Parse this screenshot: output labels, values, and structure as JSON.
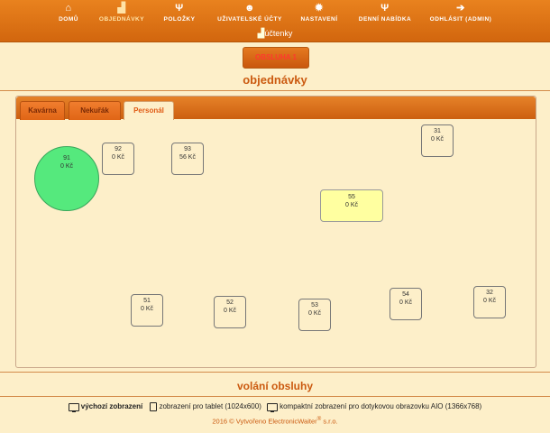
{
  "nav": {
    "items": [
      {
        "label": "DOMŮ",
        "icon": "home-icon",
        "glyph": "⌂"
      },
      {
        "label": "OBJEDNÁVKY",
        "icon": "chart-icon",
        "glyph": "▟"
      },
      {
        "label": "POLOŽKY",
        "icon": "cutlery-icon",
        "glyph": "Ψ"
      },
      {
        "label": "UŽIVATELSKÉ ÚČTY",
        "icon": "users-icon",
        "glyph": "☻"
      },
      {
        "label": "NASTAVENÍ",
        "icon": "gear-icon",
        "glyph": "✹"
      },
      {
        "label": "DENNÍ NABÍDKA",
        "icon": "cutlery-icon",
        "glyph": "Ψ"
      },
      {
        "label": "ODHLÁSIT (ADMIN)",
        "icon": "logout-icon",
        "glyph": "➔"
      }
    ],
    "sub_label": "účtenky",
    "sub_icon": "chart-icon"
  },
  "obsluha_button": "OBSLUHA 1",
  "section_title": "objednávky",
  "tabs": [
    {
      "label": "Kavárna"
    },
    {
      "label": "Nekuřák"
    },
    {
      "label": "Personál",
      "active": true
    }
  ],
  "tables": [
    {
      "number": "91",
      "amount": "0 Kč",
      "state": "green"
    },
    {
      "number": "92",
      "amount": "0 Kč",
      "state": "normal"
    },
    {
      "number": "93",
      "amount": "56 Kč",
      "state": "normal"
    },
    {
      "number": "31",
      "amount": "0 Kč",
      "state": "normal"
    },
    {
      "number": "55",
      "amount": "0 Kč",
      "state": "yellow"
    },
    {
      "number": "51",
      "amount": "0 Kč",
      "state": "normal"
    },
    {
      "number": "52",
      "amount": "0 Kč",
      "state": "normal"
    },
    {
      "number": "53",
      "amount": "0 Kč",
      "state": "normal"
    },
    {
      "number": "54",
      "amount": "0 Kč",
      "state": "normal"
    },
    {
      "number": "32",
      "amount": "0 Kč",
      "state": "normal"
    }
  ],
  "call_section": "volání obsluhy",
  "footer": {
    "default_view": "výchozí zobrazení",
    "tablet_view": "zobrazení pro tablet (1024x600)",
    "aio_view": "kompaktní zobrazení pro dotykovou obrazovku AIO (1366x768)",
    "copyright_prefix": "2016 © Vytvořeno ElectronicWaiter",
    "copyright_sup": "®",
    "copyright_suffix": " s.r.o."
  }
}
